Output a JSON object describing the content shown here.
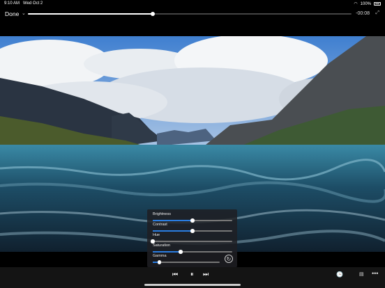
{
  "status": {
    "time": "9:10 AM",
    "date": "Wed Oct 2",
    "battery": "100%"
  },
  "top": {
    "done_label": "Done",
    "time_remaining": "-00:08",
    "progress": 0.385
  },
  "adjustments": [
    {
      "key": "brightness",
      "label": "Brightness",
      "value": 0.5
    },
    {
      "key": "contrast",
      "label": "Contrast",
      "value": 0.5
    },
    {
      "key": "hue",
      "label": "Hue",
      "value": 0.0
    },
    {
      "key": "saturation",
      "label": "Saturation",
      "value": 0.35
    },
    {
      "key": "gamma",
      "label": "Gamma",
      "value": 0.1
    }
  ],
  "controls": {
    "prev": "⏮",
    "pause": "⏸",
    "next": "⏭",
    "clock": "🕒",
    "stats": "▤",
    "more": "•••"
  },
  "colors": {
    "slider_fill": "#2a7de1"
  }
}
